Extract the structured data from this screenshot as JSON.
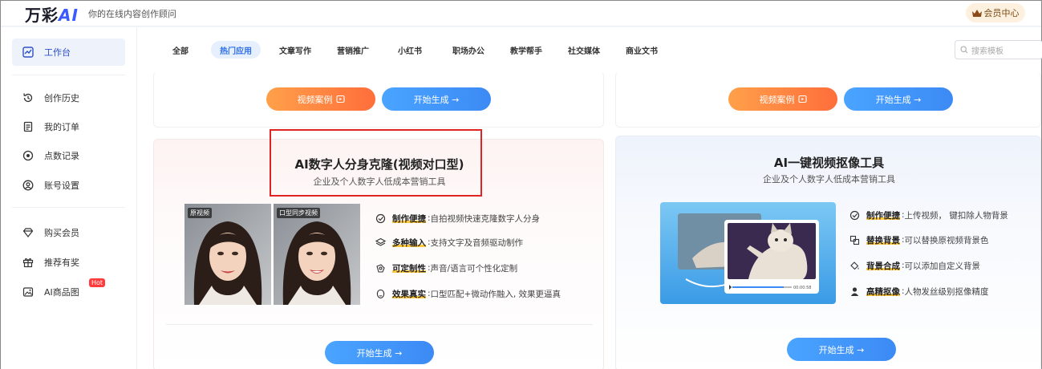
{
  "header": {
    "logo_text": "万彩",
    "logo_ai": "AI",
    "tagline": "你的在线内容创作顾问",
    "member_button": "会员中心"
  },
  "sidebar": {
    "items": [
      {
        "label": "工作台",
        "icon": "dashboard-icon",
        "active": true
      },
      {
        "label": "创作历史",
        "icon": "history-icon"
      },
      {
        "label": "我的订单",
        "icon": "order-icon"
      },
      {
        "label": "点数记录",
        "icon": "points-icon"
      },
      {
        "label": "账号设置",
        "icon": "account-icon"
      },
      {
        "label": "购买会员",
        "icon": "diamond-icon"
      },
      {
        "label": "推荐有奖",
        "icon": "gift-icon"
      },
      {
        "label": "AI商品图",
        "icon": "image-icon",
        "badge": "Hot"
      }
    ]
  },
  "tabs": {
    "items": [
      "全部",
      "热门应用",
      "文章写作",
      "营销推广",
      "小红书",
      "职场办公",
      "教学帮手",
      "社交媒体",
      "商业文书"
    ],
    "active": "热门应用",
    "search_placeholder": "搜索模板"
  },
  "cards": {
    "top_left": {
      "case_button": "视频案例",
      "start_button": "开始生成 →"
    },
    "top_right": {
      "case_button": "视频案例",
      "start_button": "开始生成 →"
    },
    "digital_human": {
      "title": "AI数字人分身克隆(视频对口型)",
      "subtitle": "企业及个人数字人低成本营销工具",
      "image_labels": [
        "原视频",
        "口型同步视频"
      ],
      "features": [
        {
          "name": "制作便捷",
          "desc": "自拍视频快速克隆数字人分身",
          "icon": "magic-icon"
        },
        {
          "name": "多种输入",
          "desc": "支持文字及音频驱动制作",
          "icon": "layers-icon"
        },
        {
          "name": "可定制性",
          "desc": "声音/语言可个性化定制",
          "icon": "custom-icon"
        },
        {
          "name": "效果真实",
          "desc": "口型匹配+微动作融入, 效果更逼真",
          "icon": "realistic-icon"
        }
      ],
      "start_button": "开始生成 →"
    },
    "matting": {
      "title": "AI一键视频抠像工具",
      "subtitle": "企业及个人数字人低成本营销工具",
      "video_time": "00:00:58",
      "features": [
        {
          "name": "制作便捷",
          "desc": "上传视频，  键扣除人物背景",
          "icon": "magic-icon"
        },
        {
          "name": "替换背景",
          "desc": "可以替换原视频背景色",
          "icon": "replace-icon"
        },
        {
          "name": "背景合成",
          "desc": "可以添加自定义背景",
          "icon": "fill-icon"
        },
        {
          "name": "高精抠像",
          "desc": "人物发丝级别抠像精度",
          "icon": "person-icon"
        }
      ],
      "start_button": "开始生成 →"
    }
  },
  "colors": {
    "accent_blue": "#3c8af5",
    "accent_orange": "#ff6e3a",
    "highlight_red": "#e02424"
  }
}
